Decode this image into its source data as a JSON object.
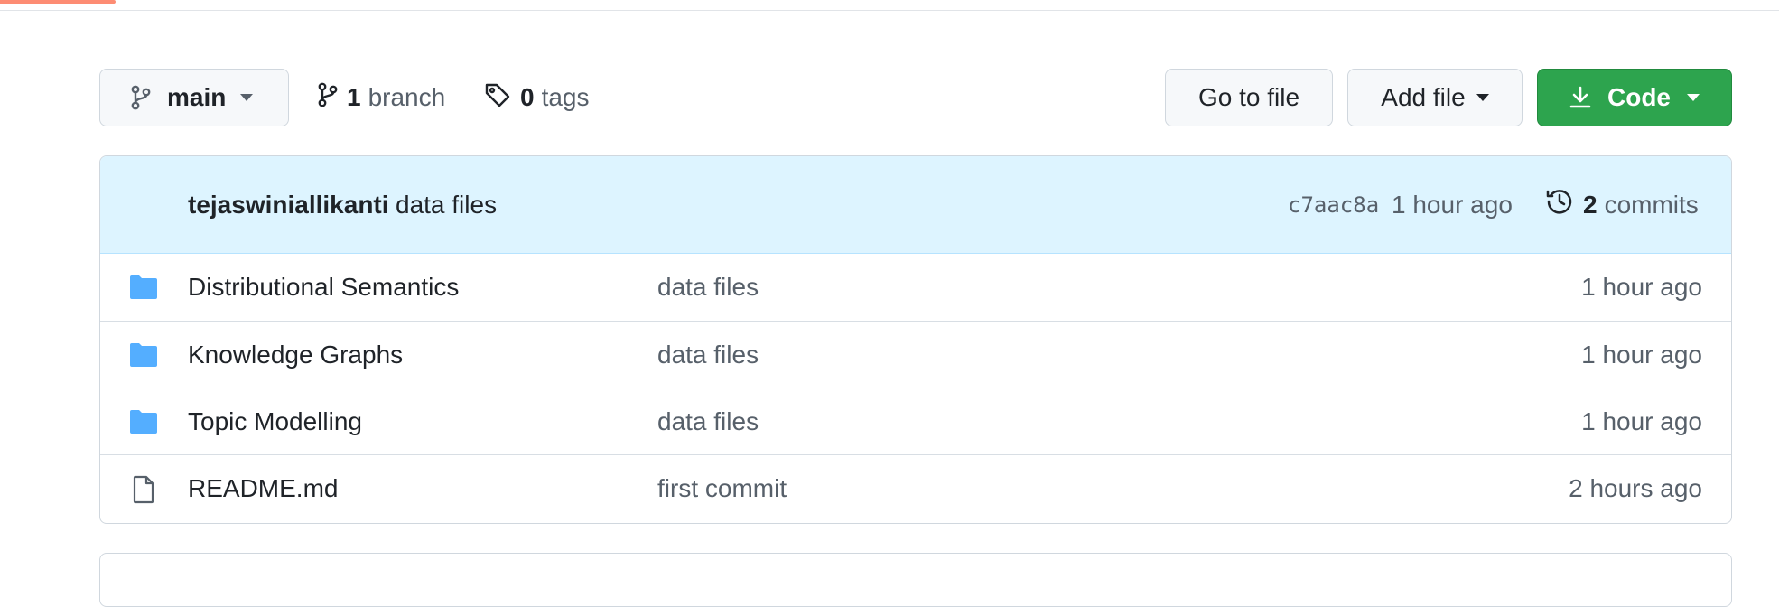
{
  "branch": {
    "name": "main"
  },
  "meta": {
    "branch_count": "1",
    "branch_label": "branch",
    "tag_count": "0",
    "tag_label": "tags"
  },
  "actions": {
    "goto_file": "Go to file",
    "add_file": "Add file",
    "code": "Code"
  },
  "latest_commit": {
    "author": "tejaswiniallikanti",
    "message": "data files",
    "hash": "c7aac8a",
    "time": "1 hour ago",
    "commit_count": "2",
    "commit_label": "commits"
  },
  "files": [
    {
      "type": "folder",
      "name": "Distributional Semantics",
      "message": "data files",
      "time": "1 hour ago"
    },
    {
      "type": "folder",
      "name": "Knowledge Graphs",
      "message": "data files",
      "time": "1 hour ago"
    },
    {
      "type": "folder",
      "name": "Topic Modelling",
      "message": "data files",
      "time": "1 hour ago"
    },
    {
      "type": "file",
      "name": "README.md",
      "message": "first commit",
      "time": "2 hours ago"
    }
  ],
  "colors": {
    "accent_tab": "#fd8c73",
    "code_button": "#2da44e",
    "header_bg": "#ddf4ff",
    "folder_icon": "#54aeff"
  },
  "icons": {
    "branch": "git-branch-icon",
    "tag": "tag-icon",
    "download": "download-icon",
    "history": "history-icon",
    "folder": "folder-icon",
    "file": "file-icon"
  }
}
